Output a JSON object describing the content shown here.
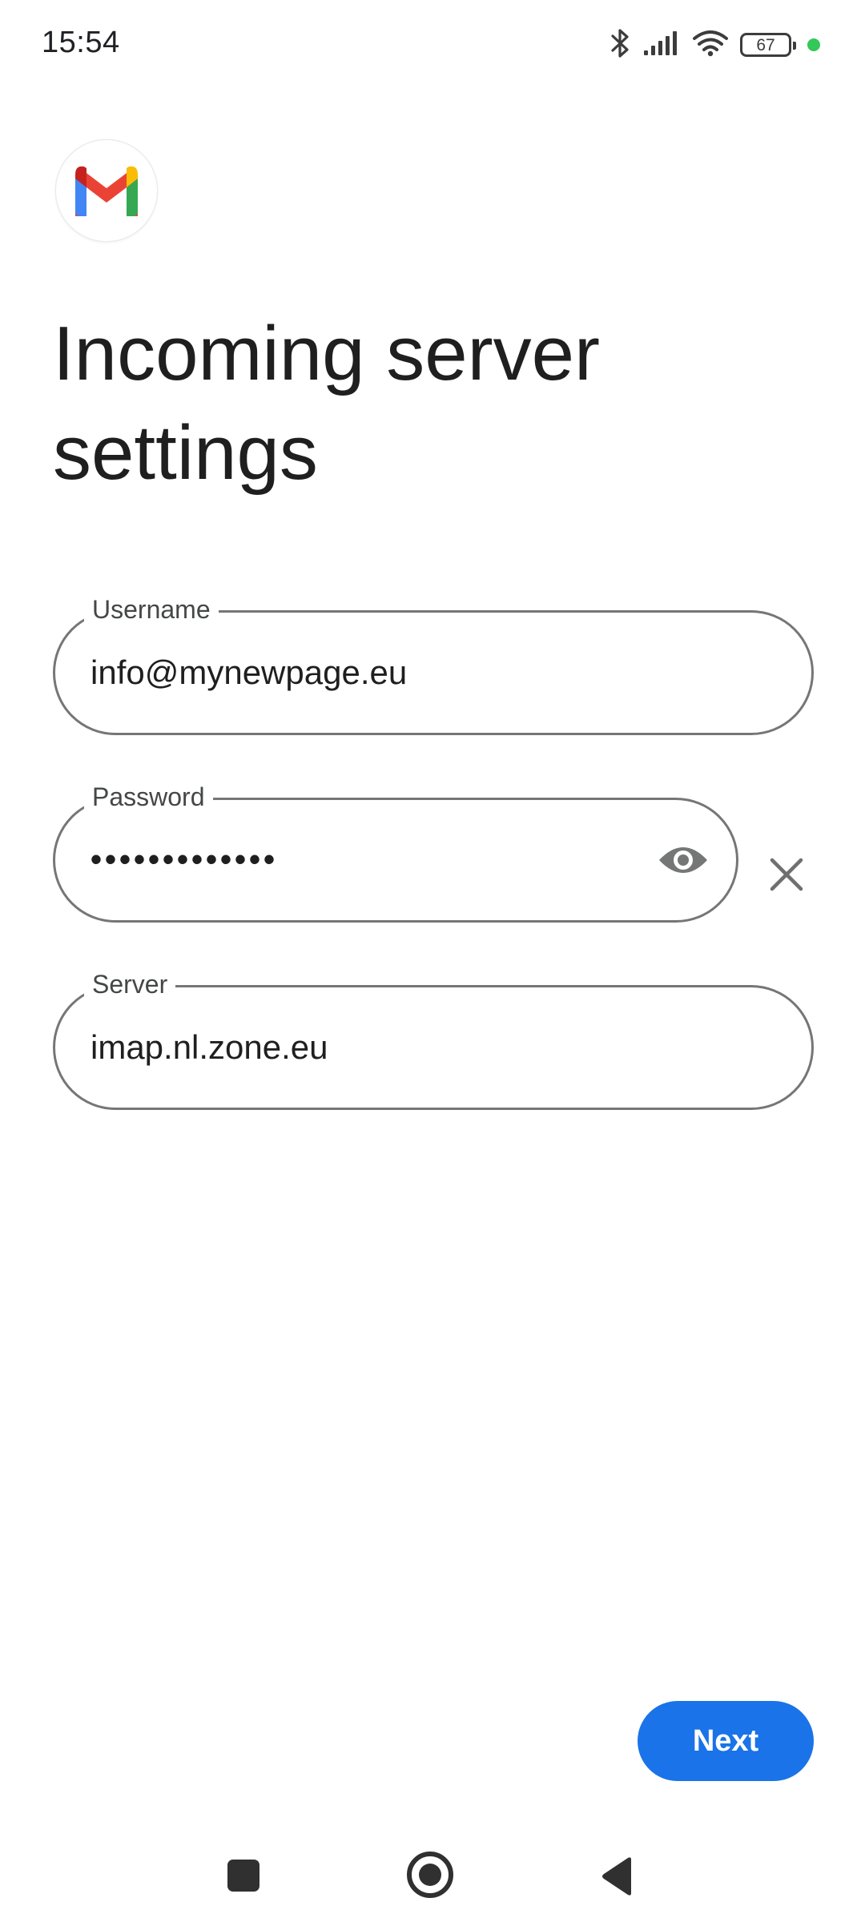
{
  "status_bar": {
    "time": "15:54",
    "battery": "67",
    "icons": [
      "bluetooth-icon",
      "signal-icon",
      "wifi-icon",
      "battery-icon",
      "privacy-dot"
    ]
  },
  "app": {
    "logo": "gmail-logo"
  },
  "page": {
    "title": "Incoming server settings"
  },
  "form": {
    "username": {
      "label": "Username",
      "value": "info@mynewpage.eu"
    },
    "password": {
      "label": "Password",
      "value": "•••••••••••••"
    },
    "server": {
      "label": "Server",
      "value": "imap.nl.zone.eu"
    }
  },
  "actions": {
    "next_label": "Next"
  },
  "colors": {
    "primary": "#1a73e8",
    "outline": "#747775",
    "privacy_dot": "#34c759"
  },
  "nav": {
    "icons": [
      "recents-icon",
      "home-icon",
      "back-icon"
    ]
  }
}
